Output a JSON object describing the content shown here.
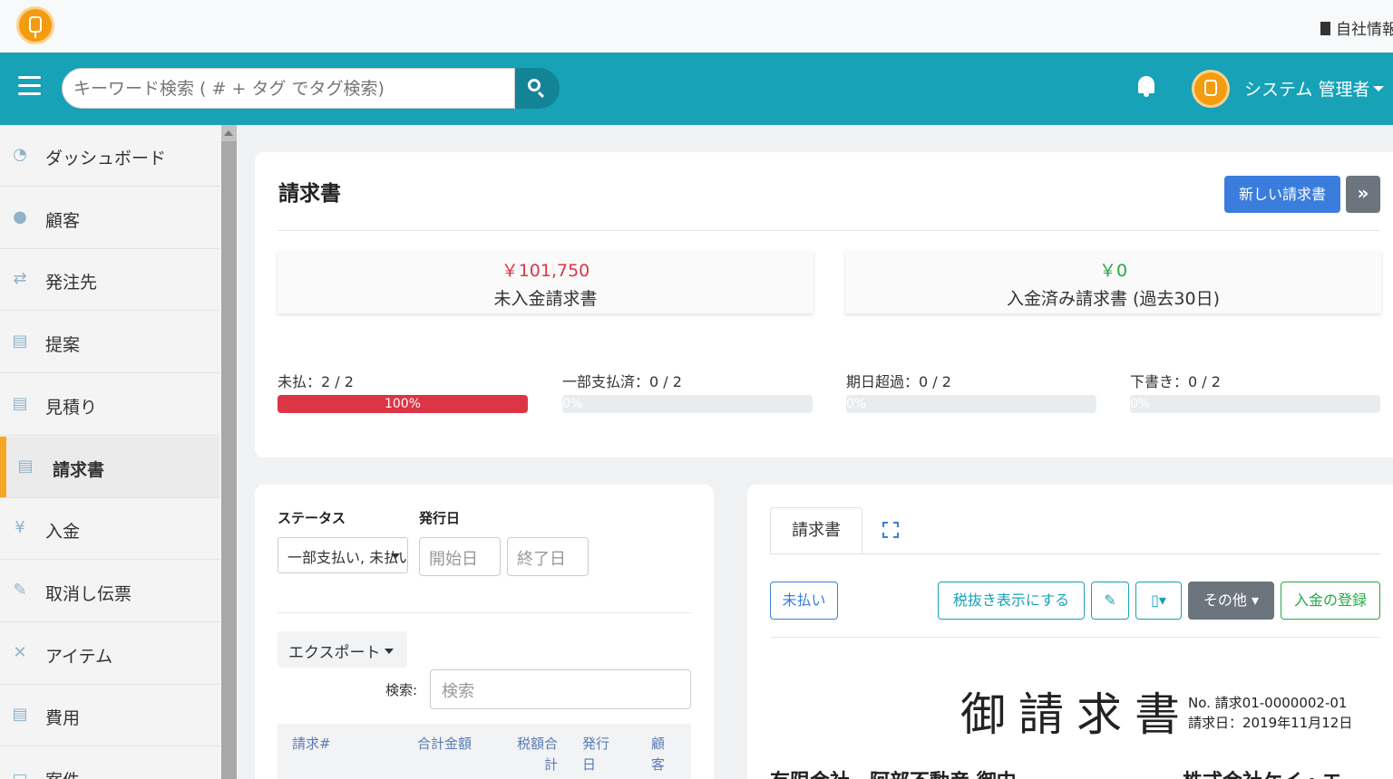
{
  "topbar": {
    "company_label": "自社情報"
  },
  "header": {
    "search_placeholder": "キーワード検索 ( # + タグ でタグ検索)",
    "user_name": "システム 管理者"
  },
  "sidebar": {
    "items": [
      {
        "label": "ダッシュボード",
        "icon": "dashboard-icon"
      },
      {
        "label": "顧客",
        "icon": "user-icon"
      },
      {
        "label": "発注先",
        "icon": "handshake-icon"
      },
      {
        "label": "提案",
        "icon": "document-icon"
      },
      {
        "label": "見積り",
        "icon": "estimate-icon"
      },
      {
        "label": "請求書",
        "icon": "invoice-icon",
        "active": true
      },
      {
        "label": "入金",
        "icon": "yen-icon"
      },
      {
        "label": "取消し伝票",
        "icon": "cancel-slip-icon"
      },
      {
        "label": "アイテム",
        "icon": "tools-icon"
      },
      {
        "label": "費用",
        "icon": "expense-icon"
      },
      {
        "label": "案件",
        "icon": "project-icon"
      }
    ]
  },
  "summary": {
    "title": "請求書",
    "new_button": "新しい請求書",
    "unpaid_amount": "￥101,750",
    "unpaid_label": "未入金請求書",
    "paid_amount": "￥0",
    "paid_label": "入金済み請求書 (過去30日)",
    "progress": [
      {
        "label": "未払：2 / 2",
        "percent_text": "100%",
        "value": 100
      },
      {
        "label": "一部支払済：0 / 2",
        "percent_text": "0%",
        "value": 0
      },
      {
        "label": "期日超過：0 / 2",
        "percent_text": "0%",
        "value": 0
      },
      {
        "label": "下書き：0 / 2",
        "percent_text": "0%",
        "value": 0
      }
    ],
    "colors": {
      "danger": "#dc3545",
      "success": "#28a745",
      "primary": "#3b7ddd",
      "teal": "#17a2b8"
    }
  },
  "filters": {
    "status_label": "ステータス",
    "status_value": "一部支払い, 未払い",
    "issue_date_label": "発行日",
    "start_placeholder": "開始日",
    "end_placeholder": "終了日",
    "export_label": "エクスポート",
    "search_label": "検索:",
    "search_placeholder": "検索",
    "columns": [
      "請求#",
      "合計金額",
      "税額合計",
      "発行日",
      "顧客"
    ]
  },
  "detail": {
    "tab_label": "請求書",
    "status_button": "未払い",
    "tax_button": "税抜き表示にする",
    "other_button": "その他",
    "payment_button": "入金の登録",
    "doc_title": "御請求書",
    "doc_no": "No. 請求01-0000002-01",
    "doc_date": "請求日：2019年11月12日",
    "customer": "有限会社　阿部不動産 御中",
    "company": "株式会社ケイ・エ"
  }
}
